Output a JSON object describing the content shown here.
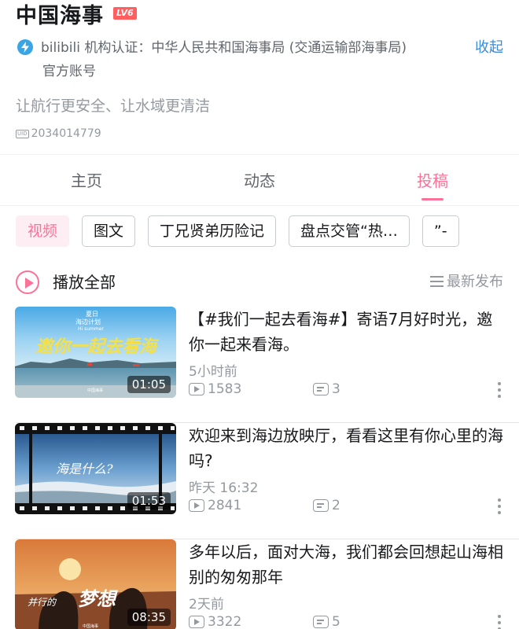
{
  "profile": {
    "name": "中国海事",
    "level": "LV6",
    "verify_line1": "bilibili 机构认证：中华人民共和国海事局 (交通运输部海事局)",
    "verify_line2": "官方账号",
    "collapse_label": "收起",
    "sign": "让航行更安全、让水域更清洁",
    "uid_label": "UID",
    "uid": "2034014779"
  },
  "tabs": [
    {
      "label": "主页",
      "active": false
    },
    {
      "label": "动态",
      "active": false
    },
    {
      "label": "投稿",
      "active": true
    }
  ],
  "chips": [
    {
      "label": "视频",
      "active": true
    },
    {
      "label": "图文",
      "active": false
    },
    {
      "label": "丁兄贤弟历险记",
      "active": false
    },
    {
      "label": "盘点交管“热…",
      "active": false
    },
    {
      "label": "”-",
      "active": false
    }
  ],
  "list_header": {
    "play_all": "播放全部",
    "sort": "最新发布"
  },
  "videos": [
    {
      "title": "【#我们一起去看海#】寄语7月好时光，邀你一起来看海。",
      "time": "5小时前",
      "views": "1583",
      "danmaku": "3",
      "duration": "01:05",
      "thumb_text": "邀你一起去看海",
      "thumb_small_top": "夏日",
      "thumb_small_mid": "海边计划",
      "thumb_small_en": "Hi summer",
      "thumb_logo": "中国海事"
    },
    {
      "title": "欢迎来到海边放映厅，看看这里有你心里的海吗?",
      "time": "昨天 16:32",
      "views": "2841",
      "danmaku": "2",
      "duration": "01:53",
      "thumb_text": "海是什么?"
    },
    {
      "title": "多年以后，面对大海，我们都会回想起山海相别的匆匆那年",
      "time": "2天前",
      "views": "3322",
      "danmaku": "5",
      "duration": "08:35",
      "thumb_text": "并行的梦想",
      "thumb_logo": "中国海事"
    }
  ],
  "colors": {
    "accent": "#fb7299",
    "link": "#3b8ad4",
    "verify": "#3aa5e5",
    "level_badge": "#ff5f5f"
  }
}
